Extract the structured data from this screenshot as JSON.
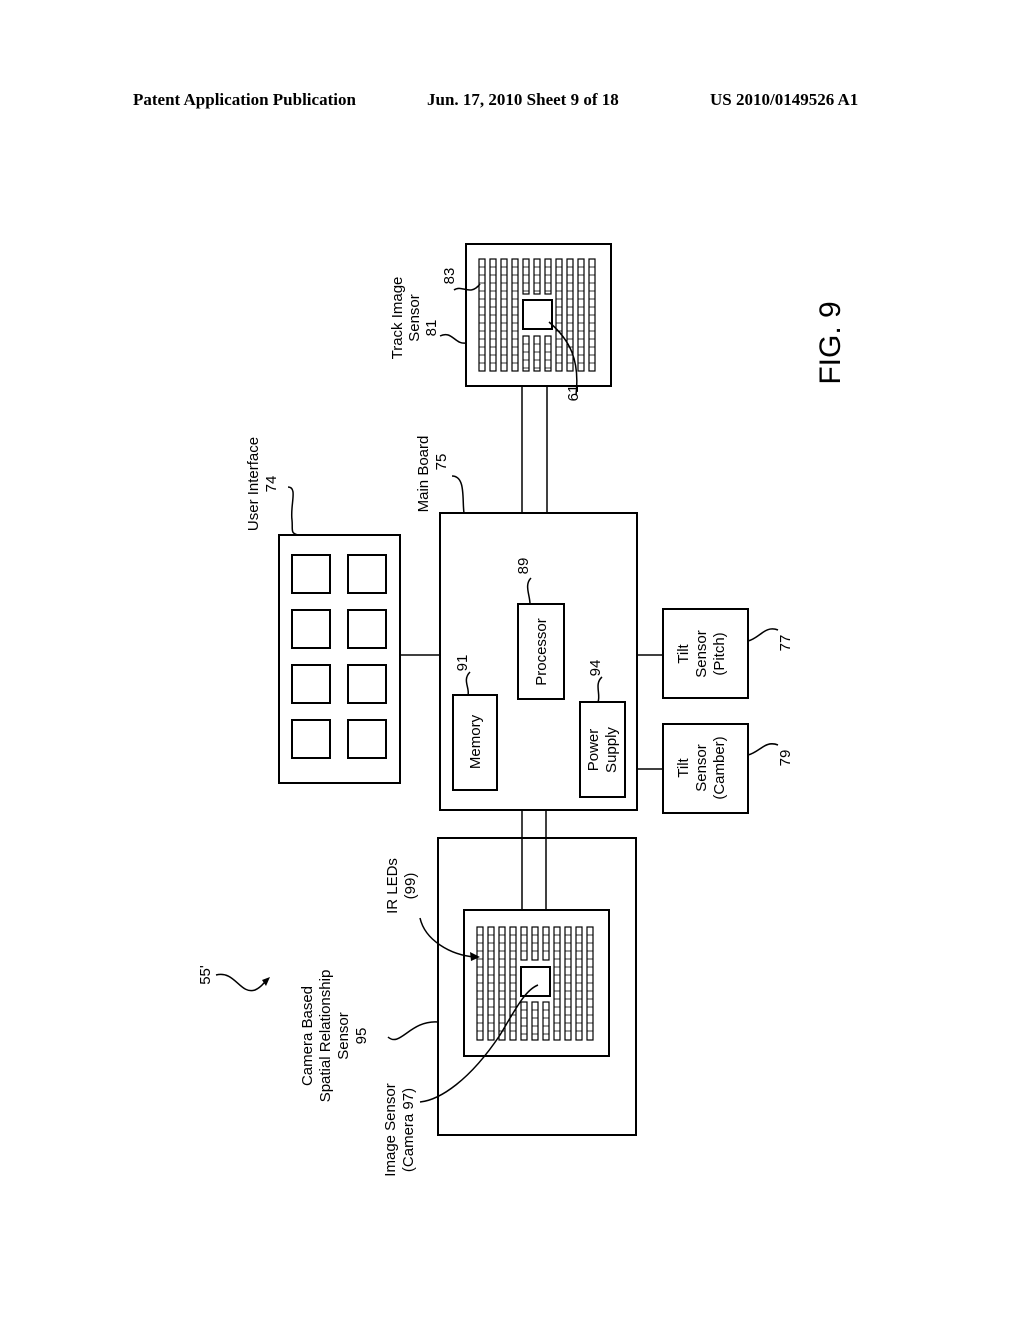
{
  "header": {
    "publication": "Patent Application Publication",
    "date_sheet": "Jun. 17, 2010  Sheet 9 of 18",
    "number": "US 2010/0149526 A1"
  },
  "figure": {
    "label": "FIG. 9",
    "system_ref": "55'",
    "track_image_sensor": {
      "name": "Track Image Sensor",
      "line1": "Track Image",
      "line2": "Sensor",
      "ref": "81",
      "led_ref": "83",
      "target_ref": "61"
    },
    "user_interface": {
      "name": "User Interface",
      "ref": "74",
      "button_count": 8
    },
    "main_board": {
      "name": "Main Board",
      "ref": "75"
    },
    "processor": {
      "name": "Processor",
      "ref": "89"
    },
    "memory": {
      "name": "Memory",
      "ref": "91"
    },
    "power_supply": {
      "line1": "Power",
      "line2": "Supply",
      "ref": "94"
    },
    "tilt_pitch": {
      "line1": "Tilt",
      "line2": "Sensor",
      "line3": "(Pitch)",
      "ref": "77"
    },
    "tilt_camber": {
      "line1": "Tilt",
      "line2": "Sensor",
      "line3": "(Camber)",
      "ref": "79"
    },
    "camera_sensor": {
      "line1": "Camera Based",
      "line2": "Spatial Relationship",
      "line3": "Sensor",
      "ref": "95"
    },
    "ir_leds": {
      "line1": "IR LEDs",
      "line2": "(99)"
    },
    "image_sensor": {
      "line1": "Image Sensor",
      "line2": "(Camera 97)"
    }
  }
}
